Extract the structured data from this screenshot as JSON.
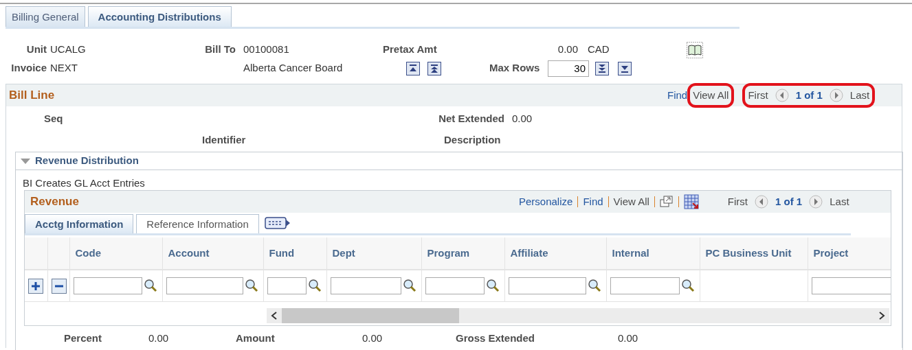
{
  "tabs": [
    {
      "label": "Billing General",
      "selected": false
    },
    {
      "label": "Accounting Distributions",
      "selected": true
    }
  ],
  "header": {
    "unit_label": "Unit",
    "unit": "UCALG",
    "invoice_label": "Invoice",
    "invoice": "NEXT",
    "bill_to_label": "Bill To",
    "bill_to": "00100081",
    "customer_name": "Alberta Cancer Board",
    "pretax_label": "Pretax Amt",
    "pretax_amount": "0.00",
    "currency": "CAD",
    "max_rows_label": "Max Rows",
    "max_rows": "30"
  },
  "bill_line": {
    "title": "Bill Line",
    "find": "Find",
    "view_all": {
      "label": "View All",
      "highlighted": true
    },
    "nav": {
      "first": "First",
      "count": "1 of 1",
      "last": "Last",
      "highlighted": true
    },
    "seq_label": "Seq",
    "net_extended_label": "Net Extended",
    "net_extended": "0.00",
    "identifier_label": "Identifier",
    "description_label": "Description"
  },
  "revenue_distribution": {
    "title": "Revenue Distribution",
    "expanded": true,
    "note": "BI Creates GL Acct Entries",
    "grid": {
      "title": "Revenue",
      "personalize": "Personalize",
      "find": "Find",
      "view_all": "View All",
      "first": "First",
      "count": "1 of 1",
      "last": "Last",
      "tabs": [
        {
          "label": "Acctg Information",
          "selected": true
        },
        {
          "label": "Reference Information",
          "selected": false
        }
      ],
      "columns": [
        {
          "label": "Code",
          "lookup": true
        },
        {
          "label": "Account",
          "lookup": true
        },
        {
          "label": "Fund",
          "lookup": true
        },
        {
          "label": "Dept",
          "lookup": true
        },
        {
          "label": "Program",
          "lookup": true
        },
        {
          "label": "Affiliate",
          "lookup": true
        },
        {
          "label": "Internal",
          "lookup": true
        },
        {
          "label": "PC Business Unit",
          "lookup": false,
          "has_field": false
        },
        {
          "label": "Project",
          "lookup": false,
          "has_field": true
        }
      ]
    },
    "percent_label": "Percent",
    "percent": "0.00",
    "amount_label": "Amount",
    "amount": "0.00",
    "gross_extended_label": "Gross Extended",
    "gross_extended": "0.00"
  }
}
